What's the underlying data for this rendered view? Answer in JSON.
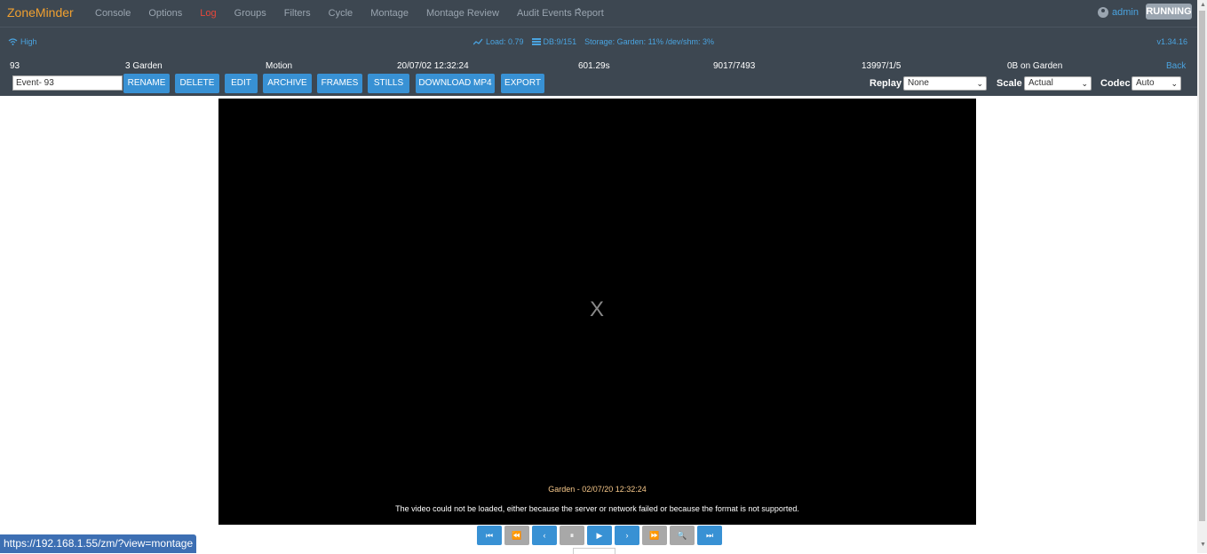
{
  "app": {
    "brand": "ZoneMinder"
  },
  "nav": {
    "items": [
      "Console",
      "Options",
      "Log",
      "Groups",
      "Filters",
      "Cycle",
      "Montage",
      "Montage Review",
      "Audit Events Report"
    ],
    "active": "Log",
    "collapse_icon": "caret-up-icon"
  },
  "user": {
    "name": "admin",
    "status": "RUNNING"
  },
  "status": {
    "bandwidth": "High",
    "load": "Load: 0.79",
    "db": "DB:9/151",
    "storage": "Storage: Garden: 11% /dev/shm: 3%",
    "version": "v1.34.16"
  },
  "event": {
    "id": "93",
    "monitor": "3 Garden",
    "cause": "Motion",
    "datetime": "20/07/02 12:32:24",
    "duration": "601.29s",
    "frames": "9017/7493",
    "scores": "13997/1/5",
    "disk": "0B on Garden",
    "back_label": "Back",
    "name_value": "Event- 93"
  },
  "toolbar": {
    "rename": "RENAME",
    "delete": "DELETE",
    "edit": "EDIT",
    "archive": "ARCHIVE",
    "frames": "FRAMES",
    "stills": "STILLS",
    "download": "DOWNLOAD MP4",
    "export": "EXPORT"
  },
  "controls_right": {
    "replay_label": "Replay",
    "replay_value": "None",
    "scale_label": "Scale",
    "scale_value": "Actual",
    "codec_label": "Codec",
    "codec_value": "Auto"
  },
  "video": {
    "placeholder": "X",
    "caption": "Garden - 02/07/20 12:32:24",
    "error": "The video could not be loaded, either because the server or network failed or because the format is not supported."
  },
  "playback": {
    "buttons": [
      {
        "name": "first-event-icon",
        "glyph": "⏮",
        "enabled": true
      },
      {
        "name": "rewind-icon",
        "glyph": "⏪",
        "enabled": false
      },
      {
        "name": "previous-frame-icon",
        "glyph": "‹",
        "enabled": true
      },
      {
        "name": "pause-icon",
        "glyph": "⏸",
        "enabled": false
      },
      {
        "name": "play-icon",
        "glyph": "▶",
        "enabled": true
      },
      {
        "name": "next-frame-icon",
        "glyph": "›",
        "enabled": true
      },
      {
        "name": "fast-forward-icon",
        "glyph": "⏩",
        "enabled": false
      },
      {
        "name": "zoom-out-icon",
        "glyph": "🔍",
        "enabled": false
      },
      {
        "name": "last-event-icon",
        "glyph": "⏭",
        "enabled": true
      }
    ]
  },
  "status_url": "https://192.168.1.55/zm/?view=montage"
}
